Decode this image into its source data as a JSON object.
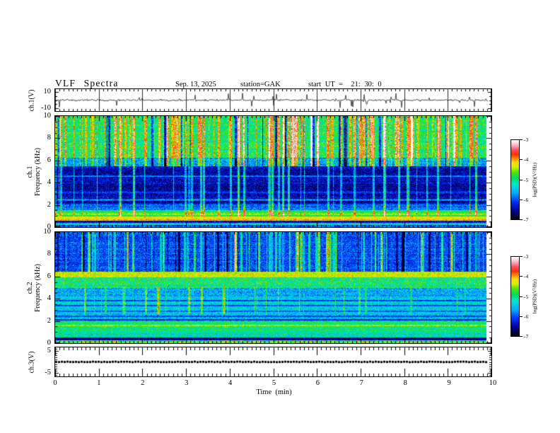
{
  "chart_data": {
    "type": "heatmap",
    "title": "VLF Spectra",
    "date": "Sep. 13, 2025",
    "station": "station=GAK",
    "start_ut": "start UT =  21: 30: 0",
    "x_axis": {
      "label": "Time  (min)",
      "range": [
        0,
        10
      ],
      "tick_values": [
        0,
        1,
        2,
        3,
        4,
        5,
        6,
        7,
        8,
        9,
        10
      ],
      "tick_labels": [
        "0",
        "1",
        "2",
        "3",
        "4",
        "5",
        "6",
        "7",
        "8",
        "9",
        "10"
      ],
      "minor_step": 0.1
    },
    "colorbar": {
      "label": "log(PSD)(V²/Hz)",
      "range": [
        -7,
        -3
      ],
      "tick_values": [
        -3,
        -4,
        -5,
        -6,
        -7
      ],
      "tick_labels": [
        "-3",
        "-4",
        "-5",
        "-6",
        "-7"
      ]
    },
    "colormap": [
      [
        0.0,
        "#000006"
      ],
      [
        0.1,
        "#00008f"
      ],
      [
        0.22,
        "#0030ff"
      ],
      [
        0.33,
        "#00aaff"
      ],
      [
        0.44,
        "#00e6d2"
      ],
      [
        0.52,
        "#00dc64"
      ],
      [
        0.6,
        "#55e600"
      ],
      [
        0.66,
        "#d2f000"
      ],
      [
        0.72,
        "#ffdc00"
      ],
      [
        0.77,
        "#ff8c00"
      ],
      [
        0.82,
        "#ff3200"
      ],
      [
        0.88,
        "#ff5064"
      ],
      [
        0.94,
        "#ffb4c8"
      ],
      [
        1.0,
        "#ffffff"
      ]
    ],
    "panels": [
      {
        "id": "ch1_wave",
        "kind": "line",
        "ylabel": "ch.1(V)",
        "ytick_values": [
          10,
          -10
        ],
        "ytick_labels": [
          "10",
          "-10"
        ],
        "yrange": [
          -13,
          13
        ],
        "minor_ticks": [
          5,
          0,
          -5
        ],
        "line_color": "#000000",
        "noise_amp": 1.6,
        "spike_prob": 0.05,
        "spike_min": 2.0,
        "spike_max": 8.5,
        "data_end": 0.992,
        "seed": 3
      },
      {
        "id": "ch1_spec",
        "kind": "heatmap",
        "ylabel_lines": [
          "ch.1",
          "Frequency (kHz)"
        ],
        "ytick_values": [
          0,
          2,
          4,
          6,
          8,
          10
        ],
        "ytick_labels": [
          "0",
          "2",
          "4",
          "6",
          "8",
          "10"
        ],
        "yrange": [
          0,
          10
        ],
        "minor_step": 0.5,
        "data_end": 0.988,
        "seed": 7,
        "bands": [
          {
            "f0": 6.25,
            "f1": 10.01,
            "v": 0.52,
            "noise": 0.11
          },
          {
            "f0": 5.45,
            "f1": 6.25,
            "v": 0.34,
            "noise": 0.13
          },
          {
            "f0": 2.1,
            "f1": 5.45,
            "v": 0.13,
            "noise": 0.1
          },
          {
            "f0": 1.55,
            "f1": 2.1,
            "v": 0.27,
            "noise": 0.09
          },
          {
            "f0": 0.95,
            "f1": 1.55,
            "v": 0.53,
            "noise": 0.08
          },
          {
            "f0": 1.1,
            "f1": 1.32,
            "v": 0.6,
            "noise": 0.07
          },
          {
            "f0": 0.78,
            "f1": 0.95,
            "v": 0.68,
            "noise": 0.06
          },
          {
            "f0": 0.6,
            "f1": 0.78,
            "v": 0.74,
            "noise": 0.07
          },
          {
            "f0": 0.4,
            "f1": 0.6,
            "v": 0.15,
            "noise": 0.1
          },
          {
            "f0": 0.16,
            "f1": 0.4,
            "v": 0.45,
            "noise": 0.16
          },
          {
            "f0": 0.0,
            "f1": 0.16,
            "v": 0.24,
            "noise": 0.12
          },
          {
            "f0": 2.38,
            "f1": 2.52,
            "v": 0.26,
            "noise": 0.08
          },
          {
            "f0": 3.05,
            "f1": 3.16,
            "v": 0.21,
            "noise": 0.08
          },
          {
            "f0": 4.55,
            "f1": 4.68,
            "v": 0.27,
            "noise": 0.08
          }
        ],
        "streaks": [
          {
            "count": 115,
            "fmin": 5.45,
            "fmax": 10,
            "dv_min": 0.1,
            "dv_max": 0.3,
            "wmax": 1
          },
          {
            "count": 24,
            "fmin": 5.45,
            "fmax": 10,
            "dv_min": -0.42,
            "dv_max": -0.26,
            "wmax": 1
          },
          {
            "count": 50,
            "fmin": 0.95,
            "fmax": 10,
            "dv_min": 0.16,
            "dv_max": 0.32,
            "wmax": 1
          }
        ]
      },
      {
        "id": "ch2_spec",
        "kind": "heatmap",
        "ylabel_lines": [
          "ch.2",
          "Frequency (kHz)"
        ],
        "ytick_values": [
          0,
          2,
          4,
          6,
          8,
          10
        ],
        "ytick_labels": [
          "0",
          "2",
          "4",
          "6",
          "8",
          "10"
        ],
        "yrange": [
          0,
          10
        ],
        "minor_step": 0.5,
        "data_end": 0.988,
        "seed": 11,
        "bands": [
          {
            "f0": 6.45,
            "f1": 10.01,
            "v": 0.24,
            "noise": 0.1
          },
          {
            "f0": 5.9,
            "f1": 6.45,
            "v": 0.68,
            "noise": 0.08
          },
          {
            "f0": 5.0,
            "f1": 5.9,
            "v": 0.5,
            "noise": 0.13
          },
          {
            "f0": 4.2,
            "f1": 5.0,
            "v": 0.34,
            "noise": 0.11
          },
          {
            "f0": 2.6,
            "f1": 4.2,
            "v": 0.4,
            "noise": 0.1
          },
          {
            "f0": 2.0,
            "f1": 2.6,
            "v": 0.37,
            "noise": 0.12
          },
          {
            "f0": 0.9,
            "f1": 2.0,
            "v": 0.5,
            "noise": 0.09
          },
          {
            "f0": 0.5,
            "f1": 0.9,
            "v": 0.44,
            "noise": 0.13
          },
          {
            "f0": 0.25,
            "f1": 0.5,
            "v": 0.1,
            "noise": 0.08
          },
          {
            "f0": 0.0,
            "f1": 0.25,
            "v": 0.55,
            "noise": 0.22
          },
          {
            "f0": 2.82,
            "f1": 2.94,
            "v": 0.24,
            "noise": 0.07
          },
          {
            "f0": 3.32,
            "f1": 3.44,
            "v": 0.24,
            "noise": 0.07
          },
          {
            "f0": 3.78,
            "f1": 3.88,
            "v": 0.24,
            "noise": 0.07
          },
          {
            "f0": 2.06,
            "f1": 2.16,
            "v": 0.2,
            "noise": 0.07
          },
          {
            "f0": 2.38,
            "f1": 2.48,
            "v": 0.22,
            "noise": 0.07
          },
          {
            "f0": 1.55,
            "f1": 1.68,
            "v": 0.62,
            "noise": 0.07
          }
        ],
        "streaks": [
          {
            "count": 105,
            "fmin": 6.45,
            "fmax": 10,
            "dv_min": 0.12,
            "dv_max": 0.3,
            "wmax": 1
          },
          {
            "count": 40,
            "fmin": 6.45,
            "fmax": 10,
            "dv_min": -0.18,
            "dv_max": -0.1,
            "wmax": 1
          },
          {
            "count": 34,
            "fmin": 2.6,
            "fmax": 5.0,
            "dv_min": 0.1,
            "dv_max": 0.24,
            "wmax": 1
          }
        ]
      },
      {
        "id": "ch3_wave",
        "kind": "flat",
        "ylabel": "ch.3(V)",
        "ytick_values": [
          5,
          -5
        ],
        "ytick_labels": [
          "5",
          "-5"
        ],
        "yrange": [
          -6.6,
          6.6
        ],
        "minor_ticks": [
          -6,
          -4,
          -3,
          -2,
          -1,
          0,
          1,
          2,
          3,
          4,
          6
        ],
        "value": 0,
        "line_color": "#000000",
        "data_end": 0.99,
        "seed": 5
      }
    ]
  }
}
